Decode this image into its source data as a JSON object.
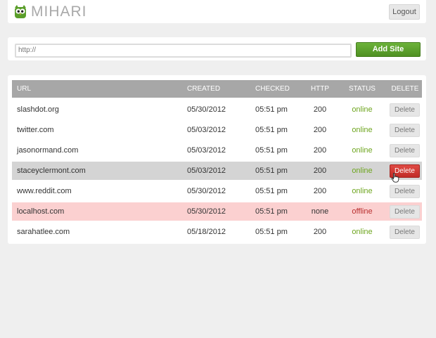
{
  "app": {
    "brand": "MIHARI",
    "logout_label": "Logout"
  },
  "add_site": {
    "url_value": "http://",
    "button_label": "Add Site"
  },
  "table": {
    "headers": {
      "url": "URL",
      "created": "CREATED",
      "checked": "CHECKED",
      "http": "HTTP",
      "status": "STATUS",
      "delete": "DELETE"
    },
    "rows": [
      {
        "url": "slashdot.org",
        "created": "05/30/2012",
        "checked": "05:51 pm",
        "http": "200",
        "status": "online",
        "delete": "Delete",
        "state": "normal"
      },
      {
        "url": "twitter.com",
        "created": "05/03/2012",
        "checked": "05:51 pm",
        "http": "200",
        "status": "online",
        "delete": "Delete",
        "state": "normal"
      },
      {
        "url": "jasonormand.com",
        "created": "05/03/2012",
        "checked": "05:51 pm",
        "http": "200",
        "status": "online",
        "delete": "Delete",
        "state": "normal"
      },
      {
        "url": "staceyclermont.com",
        "created": "05/03/2012",
        "checked": "05:51 pm",
        "http": "200",
        "status": "online",
        "delete": "Delete",
        "state": "hover"
      },
      {
        "url": "www.reddit.com",
        "created": "05/30/2012",
        "checked": "05:51 pm",
        "http": "200",
        "status": "online",
        "delete": "Delete",
        "state": "normal"
      },
      {
        "url": "localhost.com",
        "created": "05/30/2012",
        "checked": "05:51 pm",
        "http": "none",
        "status": "offline",
        "delete": "Delete",
        "state": "error"
      },
      {
        "url": "sarahatlee.com",
        "created": "05/18/2012",
        "checked": "05:51 pm",
        "http": "200",
        "status": "online",
        "delete": "Delete",
        "state": "normal"
      }
    ]
  },
  "colors": {
    "brand_green": "#5a9e2a",
    "online": "#6ea51f",
    "offline": "#b82d2d",
    "delete_active": "#c9332e",
    "error_row": "#fbd0d0"
  },
  "icons": {
    "logo": "owl-logo-icon",
    "cursor": "hand-pointer-icon"
  }
}
